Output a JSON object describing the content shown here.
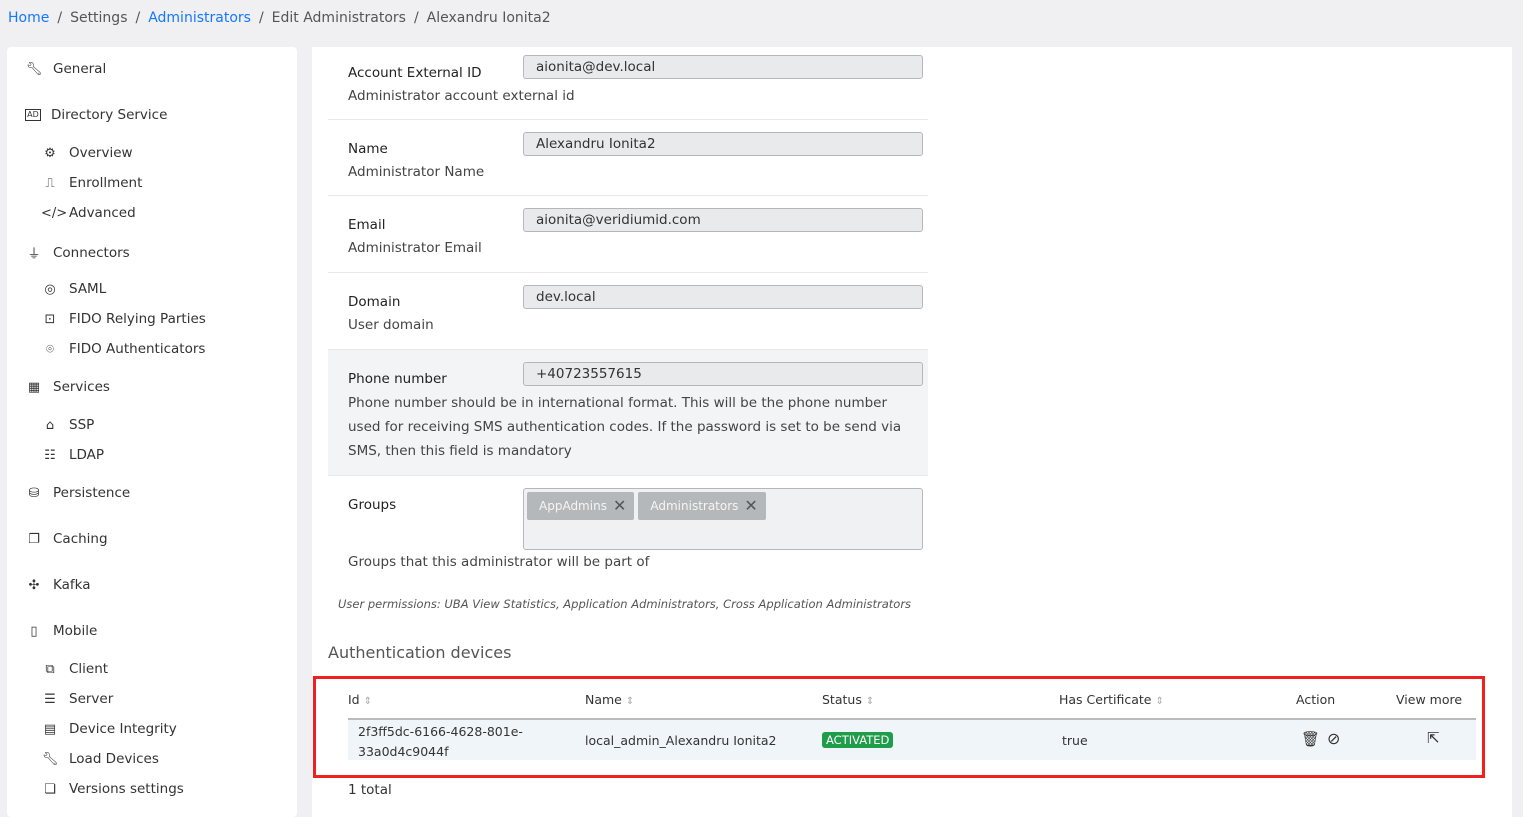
{
  "breadcrumb": [
    "Home",
    "Settings",
    "Administrators",
    "Edit Administrators",
    "Alexandru Ionita2"
  ],
  "sidebar": {
    "items": [
      {
        "label": "General",
        "icon": "wrench-icon",
        "glyph": "🔧︎",
        "level": 0
      },
      {
        "label": "Directory Service",
        "icon": "ad-icon",
        "glyph": "AD",
        "level": 0
      },
      {
        "label": "Overview",
        "icon": "overview-icon",
        "glyph": "⚙",
        "level": 1
      },
      {
        "label": "Enrollment",
        "icon": "enrollment-icon",
        "glyph": "⎍",
        "level": 1
      },
      {
        "label": "Advanced",
        "icon": "code-icon",
        "glyph": "</>",
        "level": 1
      },
      {
        "label": "Connectors",
        "icon": "plug-icon",
        "glyph": "⏚",
        "level": 0
      },
      {
        "label": "SAML",
        "icon": "saml-icon",
        "glyph": "◎",
        "level": 1
      },
      {
        "label": "FIDO Relying Parties",
        "icon": "fido-lock-icon",
        "glyph": "⊡",
        "level": 1
      },
      {
        "label": "FIDO Authenticators",
        "icon": "face-scan-icon",
        "glyph": "⌾",
        "level": 1
      },
      {
        "label": "Services",
        "icon": "grid-icon",
        "glyph": "▦",
        "level": 0
      },
      {
        "label": "SSP",
        "icon": "ssp-icon",
        "glyph": "⌂",
        "level": 1
      },
      {
        "label": "LDAP",
        "icon": "ldap-icon",
        "glyph": "☷",
        "level": 1
      },
      {
        "label": "Persistence",
        "icon": "database-icon",
        "glyph": "⛁",
        "level": 0
      },
      {
        "label": "Caching",
        "icon": "cache-icon",
        "glyph": "❐",
        "level": 0
      },
      {
        "label": "Kafka",
        "icon": "kafka-icon",
        "glyph": "✣",
        "level": 0
      },
      {
        "label": "Mobile",
        "icon": "mobile-icon",
        "glyph": "▯",
        "level": 0
      },
      {
        "label": "Client",
        "icon": "client-icon",
        "glyph": "⧉",
        "level": 1
      },
      {
        "label": "Server",
        "icon": "server-icon",
        "glyph": "☰",
        "level": 1
      },
      {
        "label": "Device Integrity",
        "icon": "device-integrity-icon",
        "glyph": "▤",
        "level": 1
      },
      {
        "label": "Load Devices",
        "icon": "load-devices-icon",
        "glyph": "🔧︎",
        "level": 1
      },
      {
        "label": "Versions settings",
        "icon": "versions-icon",
        "glyph": "❏",
        "level": 1
      }
    ]
  },
  "form": {
    "account_external_id": {
      "label": "Account External ID",
      "desc": "Administrator account external id",
      "value": "aionita@dev.local"
    },
    "name": {
      "label": "Name",
      "desc": "Administrator Name",
      "value": "Alexandru Ionita2"
    },
    "email": {
      "label": "Email",
      "desc": "Administrator Email",
      "value": "aionita@veridiumid.com"
    },
    "domain": {
      "label": "Domain",
      "desc": "User domain",
      "value": "dev.local"
    },
    "phone": {
      "label": "Phone number",
      "desc": "Phone number should be in international format. This will be the phone number used for receiving SMS authentication codes. If the password is set to be send via SMS, then this field is mandatory",
      "value": "+40723557615"
    },
    "groups": {
      "label": "Groups",
      "desc": "Groups that this administrator will be part of",
      "tags": [
        "AppAdmins",
        "Administrators"
      ]
    },
    "permissions": "User permissions: UBA View Statistics, Application Administrators, Cross Application Administrators"
  },
  "devices": {
    "title": "Authentication devices",
    "columns": [
      "Id",
      "Name",
      "Status",
      "Has Certificate",
      "Action",
      "View more"
    ],
    "rows": [
      {
        "id_line1": "2f3ff5dc-6166-4628-801e-",
        "id_line2": "33a0d4c9044f",
        "name": "local_admin_Alexandru Ionita2",
        "status": "ACTIVATED",
        "has_certificate": "true"
      }
    ],
    "total": "1 total",
    "status_color": "#1f9d4a"
  }
}
